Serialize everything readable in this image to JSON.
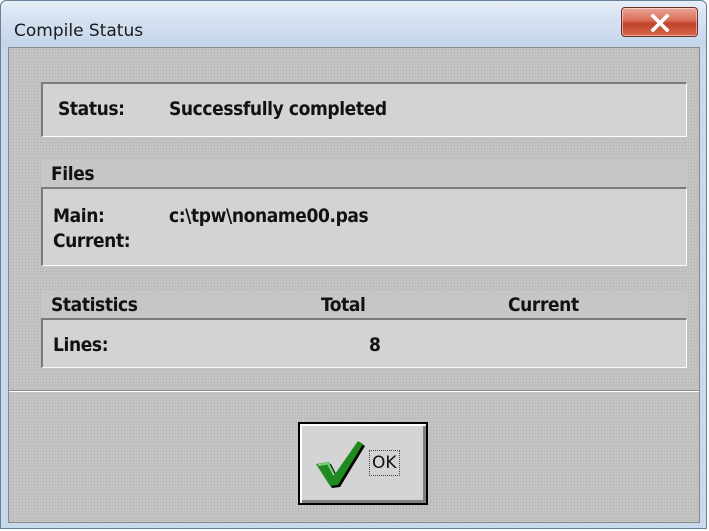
{
  "window": {
    "title": "Compile Status"
  },
  "status": {
    "label": "Status:",
    "value": "Successfully completed"
  },
  "files": {
    "header": "Files",
    "main_label": "Main:",
    "main_value": "c:\\tpw\\noname00.pas",
    "current_label": "Current:",
    "current_value": ""
  },
  "statistics": {
    "header": "Statistics",
    "total_header": "Total",
    "current_header": "Current",
    "lines_label": "Lines:",
    "lines_total": "8",
    "lines_current": ""
  },
  "ok_button": {
    "label": "OK",
    "icon": "checkmark-icon",
    "icon_color": "#1f8a1f"
  },
  "close_button": {
    "icon": "close-icon",
    "color": "#c8452e"
  }
}
